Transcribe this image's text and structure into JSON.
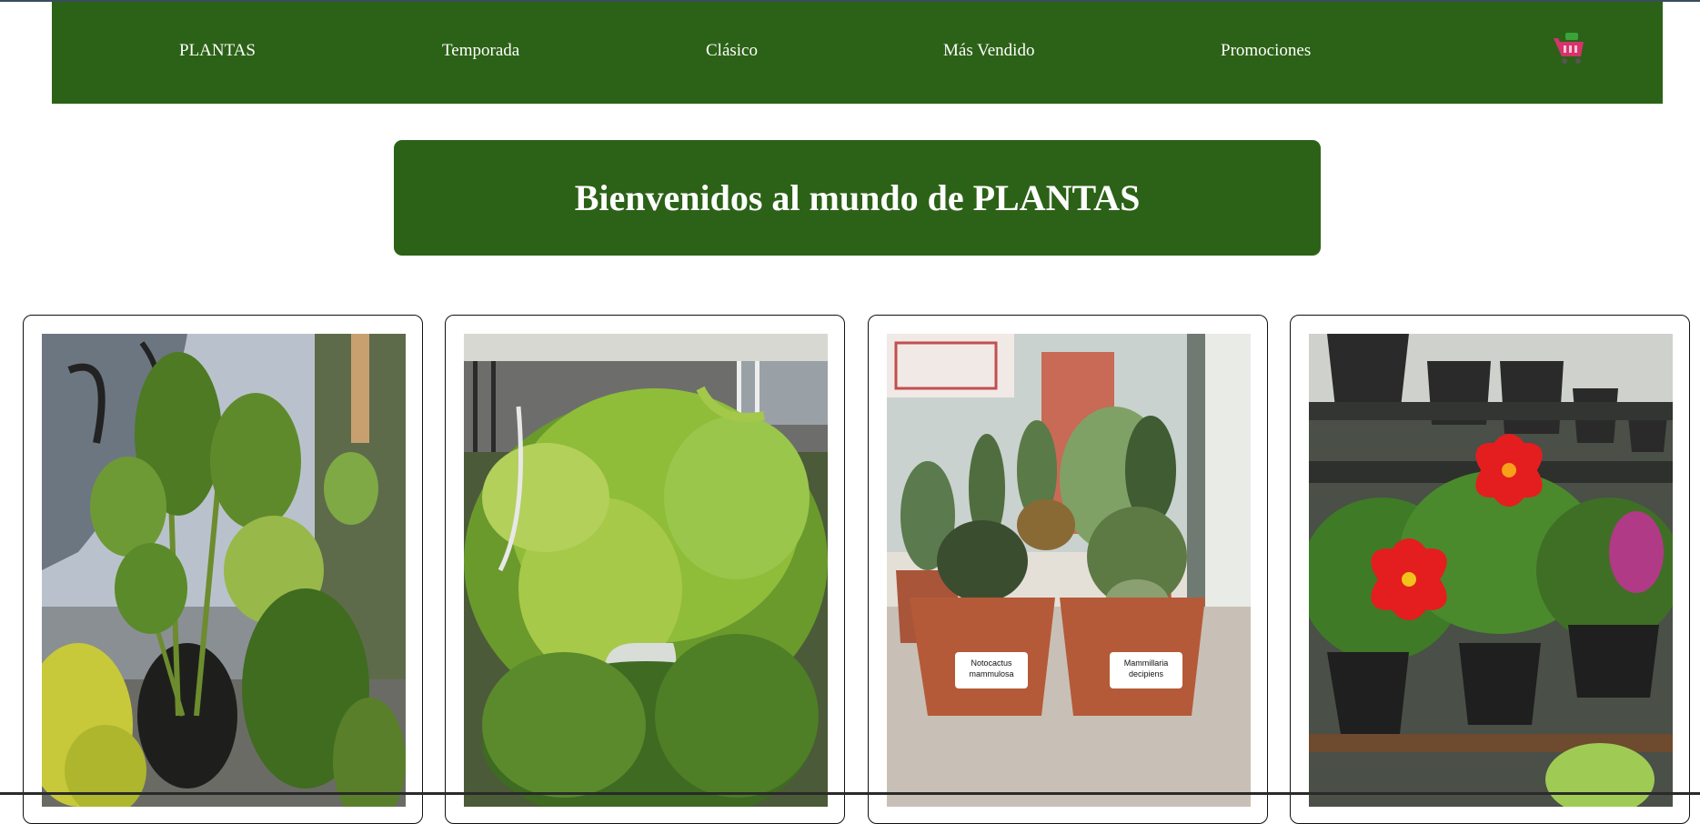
{
  "nav": {
    "items": [
      {
        "label": "PLANTAS"
      },
      {
        "label": "Temporada"
      },
      {
        "label": "Clásico"
      },
      {
        "label": "Más Vendido"
      },
      {
        "label": "Promociones"
      }
    ],
    "cart_icon": "shopping-cart-icon"
  },
  "hero": {
    "title": "Bienvenidos al mundo de PLANTAS"
  },
  "products": [
    {
      "image": "monstera-plant-photo"
    },
    {
      "image": "fern-plant-photo"
    },
    {
      "image": "cactus-pots-photo",
      "labels": [
        "Notocactus mammulosa",
        "Mammillaria decipiens"
      ]
    },
    {
      "image": "red-flower-plant-photo"
    }
  ],
  "colors": {
    "brand_green": "#2c6217",
    "text_on_brand": "#ffffff",
    "card_border": "#111111"
  }
}
